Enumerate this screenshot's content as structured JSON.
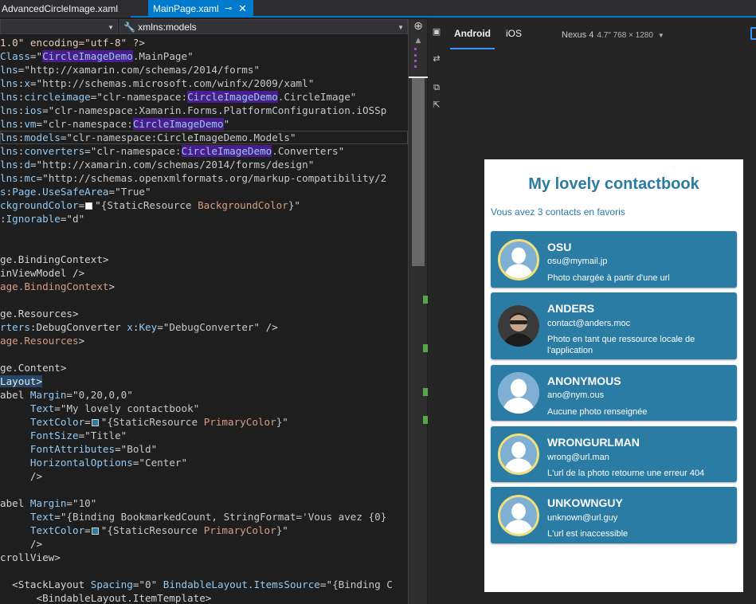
{
  "tabs": {
    "advanced": "AdvancedCircleImage.xaml",
    "main": "MainPage.xaml",
    "main_pin_icon": "⊸",
    "main_close_icon": "✕"
  },
  "navbar": {
    "left": "",
    "right": "xmlns:models"
  },
  "code_lines": [
    [
      {
        "c": "m",
        "t": "1.0\" encoding=\"utf-8\" ?>"
      }
    ],
    [
      {
        "c": "a",
        "t": "Class"
      },
      {
        "c": "t",
        "t": "=\""
      },
      {
        "c": "hl",
        "t": "CircleImageDemo"
      },
      {
        "c": "v",
        "t": ".MainPage\""
      }
    ],
    [
      {
        "c": "a",
        "t": "lns"
      },
      {
        "c": "t",
        "t": "=\""
      },
      {
        "c": "v",
        "t": "http://xamarin.com/schemas/2014/forms\""
      }
    ],
    [
      {
        "c": "a",
        "t": "lns"
      },
      {
        "c": "t",
        "t": ":"
      },
      {
        "c": "a",
        "t": "x"
      },
      {
        "c": "t",
        "t": "=\""
      },
      {
        "c": "v",
        "t": "http://schemas.microsoft.com/winfx/2009/xaml\""
      }
    ],
    [
      {
        "c": "a",
        "t": "lns"
      },
      {
        "c": "t",
        "t": ":"
      },
      {
        "c": "a",
        "t": "circleimage"
      },
      {
        "c": "t",
        "t": "=\""
      },
      {
        "c": "v",
        "t": "clr-namespace:"
      },
      {
        "c": "hl",
        "t": "CircleImageDemo"
      },
      {
        "c": "v",
        "t": ".CircleImage\""
      }
    ],
    [
      {
        "c": "a",
        "t": "lns"
      },
      {
        "c": "t",
        "t": ":"
      },
      {
        "c": "a",
        "t": "ios"
      },
      {
        "c": "t",
        "t": "=\""
      },
      {
        "c": "v",
        "t": "clr-namespace:Xamarin.Forms.PlatformConfiguration.iOSSp"
      }
    ],
    [
      {
        "c": "a",
        "t": "lns"
      },
      {
        "c": "t",
        "t": ":"
      },
      {
        "c": "a",
        "t": "vm"
      },
      {
        "c": "t",
        "t": "=\""
      },
      {
        "c": "v",
        "t": "clr-namespace:"
      },
      {
        "c": "hl",
        "t": "CircleImageDemo"
      },
      {
        "c": "v",
        "t": "\""
      }
    ],
    [
      {
        "c": "a",
        "t": "lns"
      },
      {
        "c": "t",
        "t": ":"
      },
      {
        "c": "a",
        "t": "models"
      },
      {
        "c": "t",
        "t": "=\""
      },
      {
        "c": "v",
        "t": "clr-namespace:CircleImageDemo.Models\""
      }
    ],
    [
      {
        "c": "a",
        "t": "lns"
      },
      {
        "c": "t",
        "t": ":"
      },
      {
        "c": "a",
        "t": "converters"
      },
      {
        "c": "t",
        "t": "=\""
      },
      {
        "c": "v",
        "t": "clr-namespace:"
      },
      {
        "c": "hl",
        "t": "CircleImageDemo"
      },
      {
        "c": "v",
        "t": ".Converters\""
      }
    ],
    [
      {
        "c": "a",
        "t": "lns"
      },
      {
        "c": "t",
        "t": ":"
      },
      {
        "c": "a",
        "t": "d"
      },
      {
        "c": "t",
        "t": "=\""
      },
      {
        "c": "v",
        "t": "http://xamarin.com/schemas/2014/forms/design\""
      }
    ],
    [
      {
        "c": "a",
        "t": "lns"
      },
      {
        "c": "t",
        "t": ":"
      },
      {
        "c": "a",
        "t": "mc"
      },
      {
        "c": "t",
        "t": "=\""
      },
      {
        "c": "v",
        "t": "http://schemas.openxmlformats.org/markup-compatibility/2"
      }
    ],
    [
      {
        "c": "a",
        "t": "s"
      },
      {
        "c": "t",
        "t": ":"
      },
      {
        "c": "a",
        "t": "Page.UseSafeArea"
      },
      {
        "c": "t",
        "t": "=\""
      },
      {
        "c": "v",
        "t": "True\""
      }
    ],
    [
      {
        "c": "a",
        "t": "ckgroundColor"
      },
      {
        "c": "t",
        "t": "="
      },
      {
        "c": "sw",
        "col": "#ffffff"
      },
      {
        "c": "t",
        "t": "\""
      },
      {
        "c": "v",
        "t": "{StaticResource "
      },
      {
        "c": "b",
        "t": "BackgroundColor"
      },
      {
        "c": "v",
        "t": "}\""
      }
    ],
    [
      {
        "c": "t",
        "t": ":"
      },
      {
        "c": "a",
        "t": "Ignorable"
      },
      {
        "c": "t",
        "t": "=\""
      },
      {
        "c": "v",
        "t": "d\""
      }
    ],
    [
      {
        "c": "t",
        "t": ""
      }
    ],
    [
      {
        "c": "t",
        "t": ""
      }
    ],
    [
      {
        "c": "t",
        "t": "ge.BindingContext>"
      }
    ],
    [
      {
        "c": "t",
        "t": "inViewModel />"
      }
    ],
    [
      {
        "c": "b",
        "t": "age.BindingContext"
      },
      {
        "c": "t",
        "t": ">"
      }
    ],
    [
      {
        "c": "t",
        "t": ""
      }
    ],
    [
      {
        "c": "t",
        "t": "ge.Resources>"
      }
    ],
    [
      {
        "c": "a",
        "t": "rters"
      },
      {
        "c": "t",
        "t": ":DebugConverter "
      },
      {
        "c": "a",
        "t": "x"
      },
      {
        "c": "t",
        "t": ":"
      },
      {
        "c": "a",
        "t": "Key"
      },
      {
        "c": "t",
        "t": "=\""
      },
      {
        "c": "v",
        "t": "DebugConverter\""
      },
      {
        "c": "t",
        "t": " />"
      }
    ],
    [
      {
        "c": "b",
        "t": "age.Resources"
      },
      {
        "c": "t",
        "t": ">"
      }
    ],
    [
      {
        "c": "t",
        "t": ""
      }
    ],
    [
      {
        "c": "t",
        "t": "ge.Content>"
      }
    ],
    [
      {
        "c": "ys",
        "t": "Layout>"
      }
    ],
    [
      {
        "c": "t",
        "t": "abel "
      },
      {
        "c": "a",
        "t": "Margin"
      },
      {
        "c": "t",
        "t": "=\""
      },
      {
        "c": "v",
        "t": "0,20,0,0\""
      }
    ],
    [
      {
        "c": "t",
        "t": "     "
      },
      {
        "c": "a",
        "t": "Text"
      },
      {
        "c": "t",
        "t": "=\""
      },
      {
        "c": "v",
        "t": "My lovely contactbook\""
      }
    ],
    [
      {
        "c": "t",
        "t": "     "
      },
      {
        "c": "a",
        "t": "TextColor"
      },
      {
        "c": "t",
        "t": "="
      },
      {
        "c": "sw",
        "col": "#2b7ba3"
      },
      {
        "c": "t",
        "t": "\""
      },
      {
        "c": "v",
        "t": "{StaticResource "
      },
      {
        "c": "b",
        "t": "PrimaryColor"
      },
      {
        "c": "v",
        "t": "}\""
      }
    ],
    [
      {
        "c": "t",
        "t": "     "
      },
      {
        "c": "a",
        "t": "FontSize"
      },
      {
        "c": "t",
        "t": "=\""
      },
      {
        "c": "v",
        "t": "Title\""
      }
    ],
    [
      {
        "c": "t",
        "t": "     "
      },
      {
        "c": "a",
        "t": "FontAttributes"
      },
      {
        "c": "t",
        "t": "=\""
      },
      {
        "c": "v",
        "t": "Bold\""
      }
    ],
    [
      {
        "c": "t",
        "t": "     "
      },
      {
        "c": "a",
        "t": "HorizontalOptions"
      },
      {
        "c": "t",
        "t": "=\""
      },
      {
        "c": "v",
        "t": "Center\""
      }
    ],
    [
      {
        "c": "t",
        "t": "     />"
      }
    ],
    [
      {
        "c": "t",
        "t": ""
      }
    ],
    [
      {
        "c": "t",
        "t": "abel "
      },
      {
        "c": "a",
        "t": "Margin"
      },
      {
        "c": "t",
        "t": "=\""
      },
      {
        "c": "v",
        "t": "10\""
      }
    ],
    [
      {
        "c": "t",
        "t": "     "
      },
      {
        "c": "a",
        "t": "Text"
      },
      {
        "c": "t",
        "t": "=\""
      },
      {
        "c": "v",
        "t": "{Binding BookmarkedCount, StringFormat='Vous avez {0}"
      }
    ],
    [
      {
        "c": "t",
        "t": "     "
      },
      {
        "c": "a",
        "t": "TextColor"
      },
      {
        "c": "t",
        "t": "="
      },
      {
        "c": "sw",
        "col": "#2b7ba3"
      },
      {
        "c": "t",
        "t": "\""
      },
      {
        "c": "v",
        "t": "{StaticResource "
      },
      {
        "c": "b",
        "t": "PrimaryColor"
      },
      {
        "c": "v",
        "t": "}\""
      }
    ],
    [
      {
        "c": "t",
        "t": "     />"
      }
    ],
    [
      {
        "c": "t",
        "t": "crollView>"
      }
    ],
    [
      {
        "c": "t",
        "t": ""
      }
    ],
    [
      {
        "c": "t",
        "t": "  <StackLayout "
      },
      {
        "c": "a",
        "t": "Spacing"
      },
      {
        "c": "t",
        "t": "=\""
      },
      {
        "c": "v",
        "t": "0\""
      },
      {
        "c": "t",
        "t": " "
      },
      {
        "c": "a",
        "t": "BindableLayout.ItemsSource"
      },
      {
        "c": "t",
        "t": "=\""
      },
      {
        "c": "v",
        "t": "{Binding C"
      }
    ],
    [
      {
        "c": "t",
        "t": "      <BindableLayout.ItemTemplate>"
      }
    ]
  ],
  "scrollbar": {
    "split_icon": "⊕",
    "up_arrow": "▲",
    "down_arrow": "▼"
  },
  "toolstrip_icons": [
    "▣",
    "⇄",
    "⧉",
    "⇱"
  ],
  "preview": {
    "tab_android": "Android",
    "tab_ios": "iOS",
    "device_name": "Nexus 4",
    "device_size": "4.7\" 768 × 1280",
    "device_chevron": "▼"
  },
  "app": {
    "title": "My lovely contactbook",
    "count_label": "Vous avez 3 contacts en favoris",
    "contacts": [
      {
        "name": "OSU",
        "email": "osu@mymail.jp",
        "desc": "Photo chargée à partir d'une url",
        "avatar": "placeholder",
        "avatar_border": true
      },
      {
        "name": "ANDERS",
        "email": "contact@anders.moc",
        "desc": "Photo en tant que ressource locale de l'application",
        "avatar": "photo",
        "avatar_border": false
      },
      {
        "name": "ANONYMOUS",
        "email": "ano@nym.ous",
        "desc": "Aucune photo renseignée",
        "avatar": "placeholder",
        "avatar_border": false
      },
      {
        "name": "WRONGURLMAN",
        "email": "wrong@url.man",
        "desc": "L'url de la photo retourne une erreur 404",
        "avatar": "placeholder",
        "avatar_border": true
      },
      {
        "name": "UNKOWNGUY",
        "email": "unknown@url.guy",
        "desc": "L'url est inaccessible",
        "avatar": "placeholder",
        "avatar_border": true
      }
    ]
  },
  "colors": {
    "accent": "#007acc",
    "primary": "#2b7ba3",
    "card": "#2a7ca4",
    "avatar_border": "#f1e07a"
  }
}
